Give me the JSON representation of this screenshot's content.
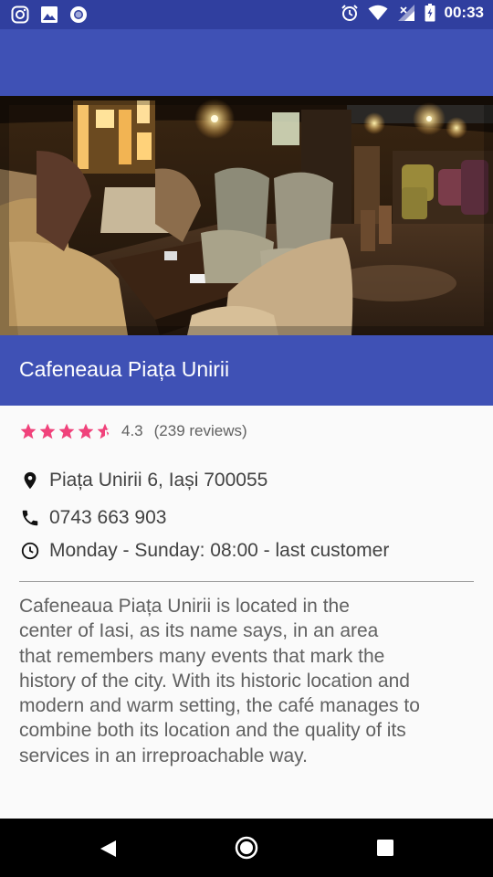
{
  "status_bar": {
    "time": "00:33",
    "left_icons": [
      "instagram-icon",
      "image-icon",
      "circle-notification-icon"
    ],
    "right_icons": [
      "alarm-icon",
      "wifi-icon",
      "signal-icon",
      "battery-icon"
    ],
    "colors": {
      "background": "#303f9f"
    }
  },
  "app_bar": {
    "colors": {
      "background": "#3f51b5"
    }
  },
  "hero": {
    "image": "cafe-interior-photo"
  },
  "place": {
    "title": "Cafeneaua Piața Unirii",
    "rating": {
      "value": "4.3",
      "stars_filled": 4.5,
      "stars_total": 5,
      "reviews": "(239 reviews)",
      "star_color": "#f0427b"
    },
    "address": "Piața Unirii 6, Iași 700055",
    "phone": "0743 663 903",
    "hours": "Monday - Sunday: 08:00 - last customer",
    "description_lines": [
      "Cafeneaua Piața Unirii is located in the",
      "center of Iasi, as its name says, in an area",
      "that remembers many events that mark the",
      "history of the city. With its historic location and",
      "modern and warm setting, the café manages to",
      "combine both its location and the quality of its",
      "services in an irreproachable way."
    ]
  },
  "nav_bar": {
    "buttons": [
      "back-button",
      "home-button",
      "recents-button"
    ]
  }
}
